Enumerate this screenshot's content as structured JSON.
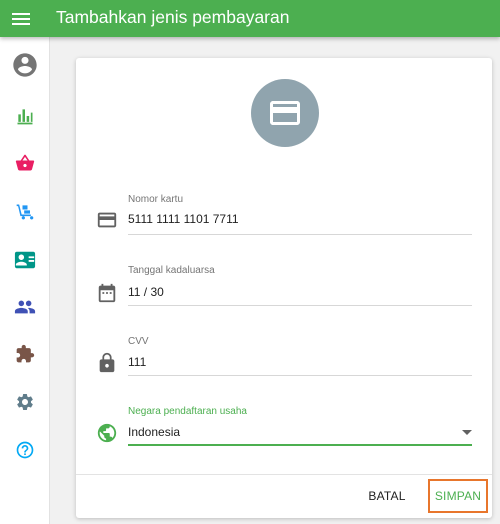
{
  "appbar": {
    "title": "Tambahkan jenis pembayaran"
  },
  "sidebar": {
    "items": [
      {
        "icon": "account-circle-icon",
        "color": "#757575"
      },
      {
        "icon": "bar-chart-icon",
        "color": "#4caf50"
      },
      {
        "icon": "shopping-basket-icon",
        "color": "#e91e63"
      },
      {
        "icon": "dolly-icon",
        "color": "#2196f3"
      },
      {
        "icon": "contact-card-icon",
        "color": "#009688"
      },
      {
        "icon": "people-icon",
        "color": "#3f51b5"
      },
      {
        "icon": "puzzle-icon",
        "color": "#795548"
      },
      {
        "icon": "gear-icon",
        "color": "#607d8b"
      },
      {
        "icon": "help-icon",
        "color": "#03a9f4"
      }
    ]
  },
  "form": {
    "card_number": {
      "label": "Nomor kartu",
      "value": "5111 1111 1101 7711"
    },
    "expiry": {
      "label": "Tanggal kadaluarsa",
      "value": "11 / 30"
    },
    "cvv": {
      "label": "CVV",
      "value": "111"
    },
    "country": {
      "label": "Negara pendaftaran usaha",
      "value": "Indonesia"
    }
  },
  "actions": {
    "cancel_label": "BATAL",
    "save_label": "SIMPAN"
  },
  "colors": {
    "primary": "#4caf50",
    "highlight": "#e8762c",
    "avatar": "#90a4ae"
  }
}
